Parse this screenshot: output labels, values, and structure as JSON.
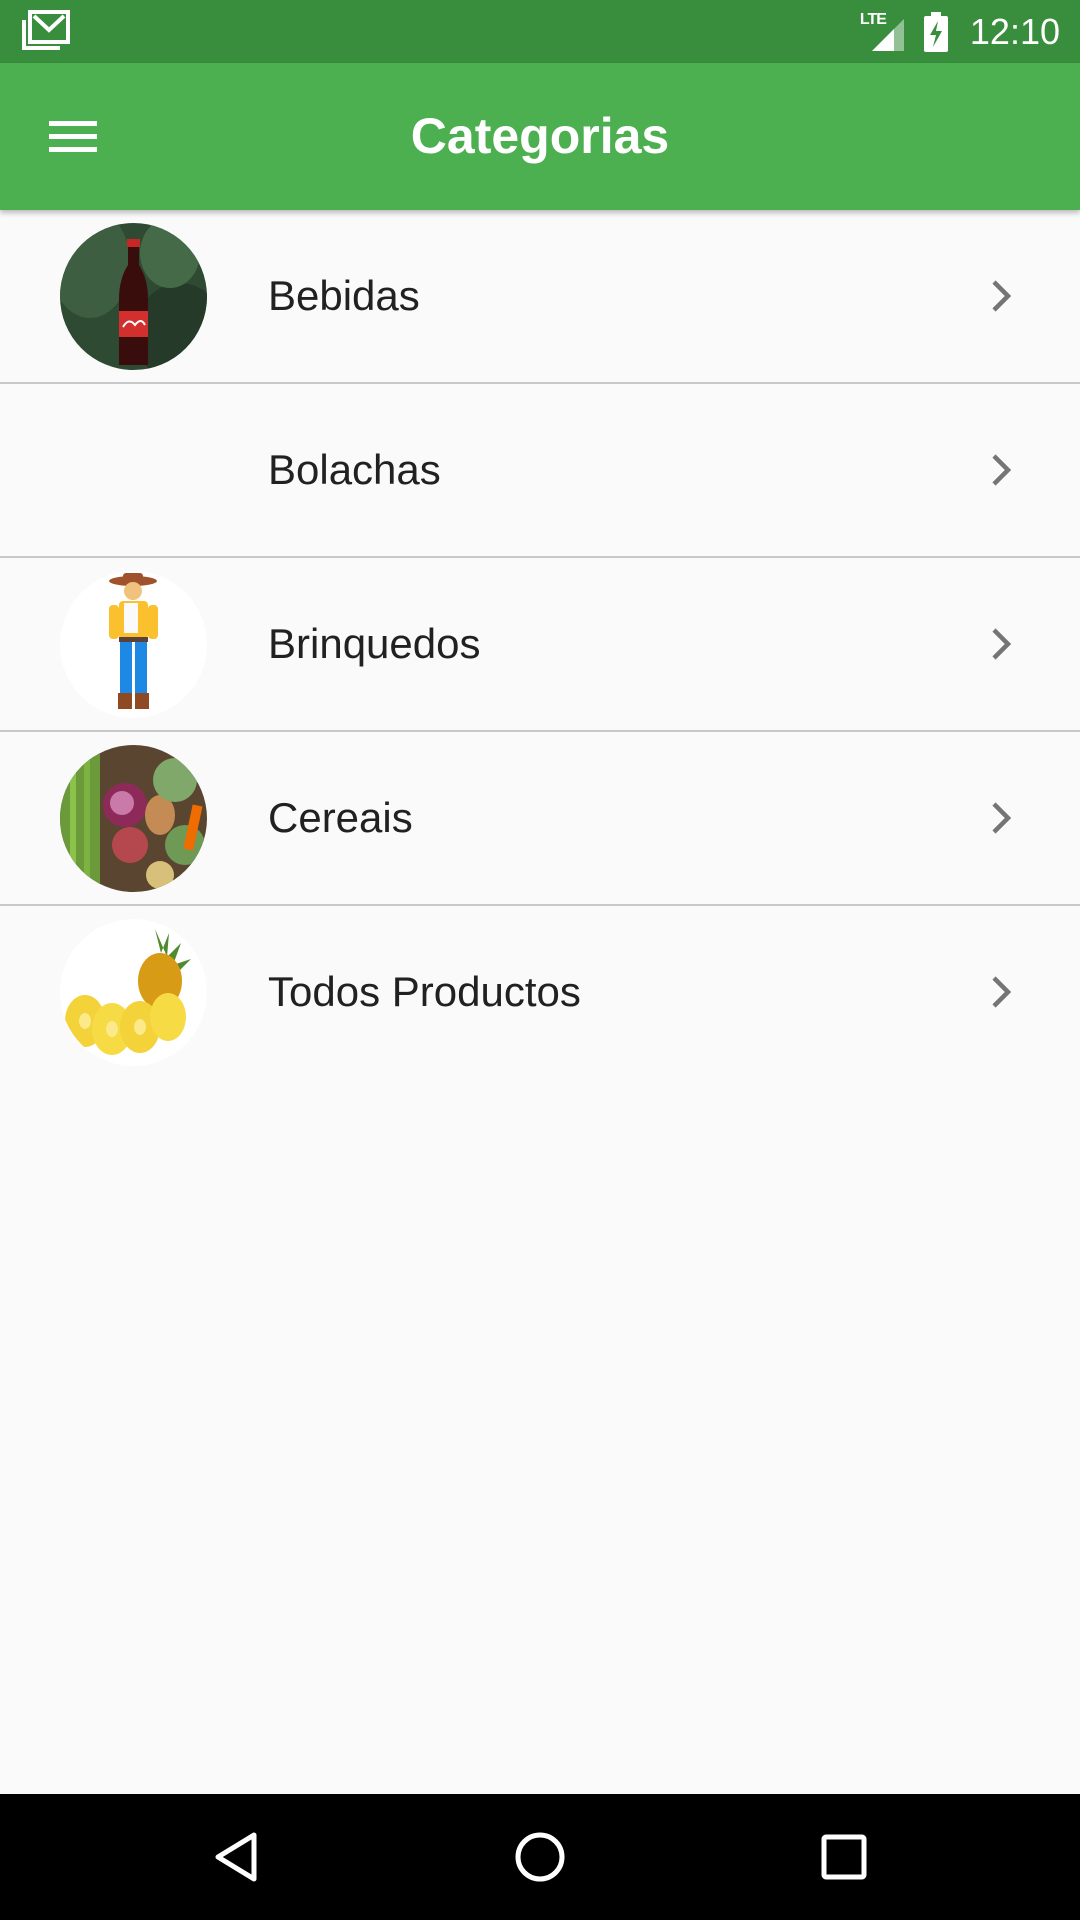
{
  "status_bar": {
    "time": "12:10",
    "network_label": "LTE",
    "left_icon": "gmail-stack-icon",
    "battery_icon": "battery-charging-icon",
    "signal_icon": "signal-icon",
    "background": "#388e3c"
  },
  "app_bar": {
    "title": "Categorias",
    "menu_icon": "hamburger-menu-icon",
    "background": "#4caf50"
  },
  "categories": [
    {
      "label": "Bebidas",
      "image": "coca-cola-bottle"
    },
    {
      "label": "Bolachas",
      "image": ""
    },
    {
      "label": "Brinquedos",
      "image": "woody-toy"
    },
    {
      "label": "Cereais",
      "image": "vegetables"
    },
    {
      "label": "Todos Productos",
      "image": "pineapple"
    }
  ],
  "nav_bar": {
    "back_icon": "back-triangle-icon",
    "home_icon": "home-circle-icon",
    "recents_icon": "recents-square-icon"
  }
}
